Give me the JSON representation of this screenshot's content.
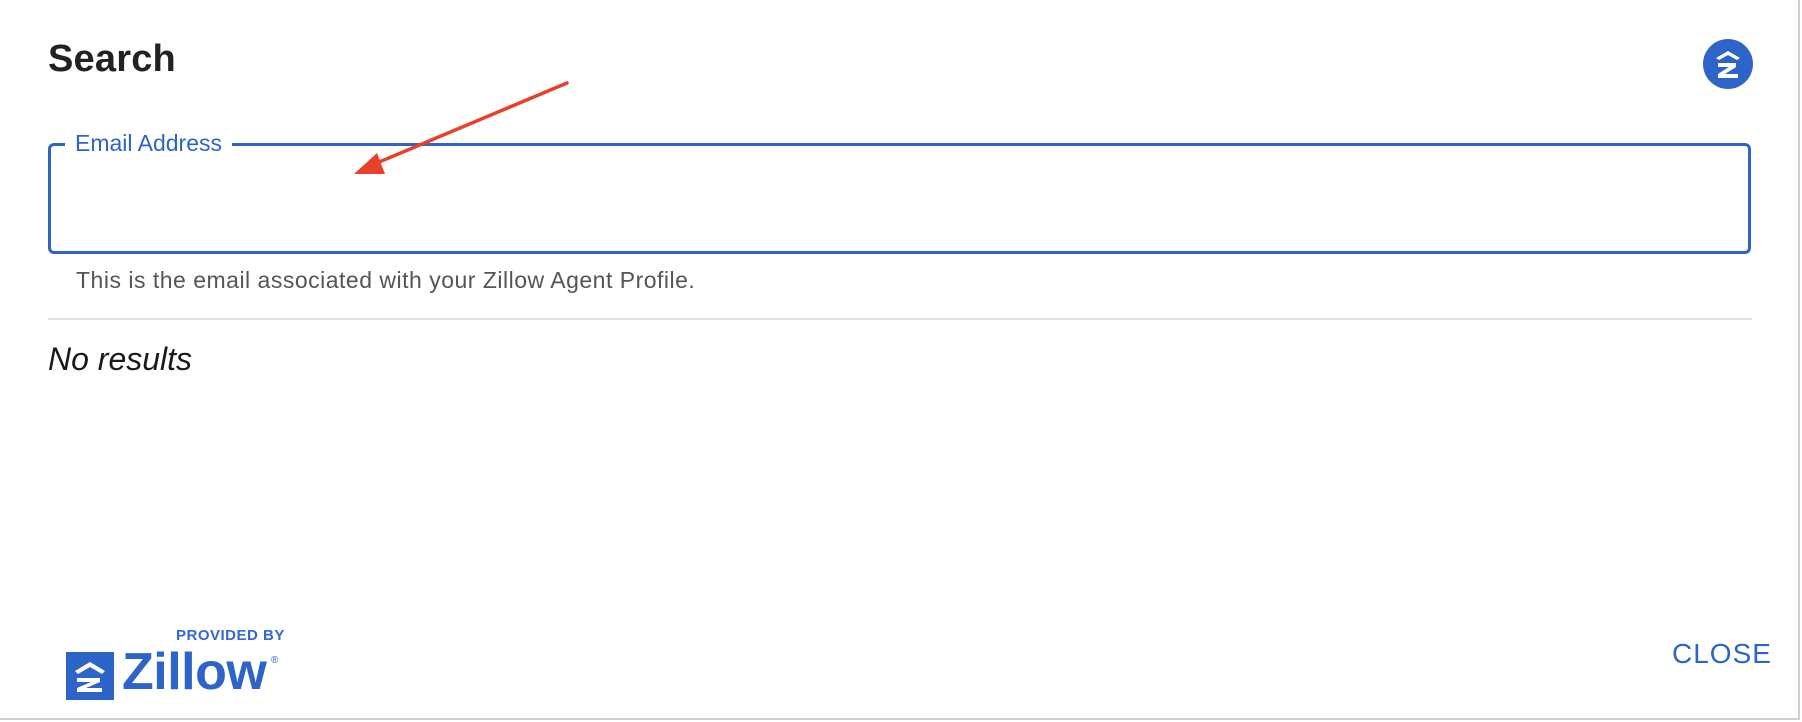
{
  "dialog": {
    "title": "Search",
    "close_label": "CLOSE"
  },
  "email_field": {
    "label": "Email Address",
    "value": "",
    "helper_text": "This is the email associated with your Zillow Agent Profile."
  },
  "results": {
    "empty_message": "No results"
  },
  "footer": {
    "provided_by": "PROVIDED BY",
    "brand": "Zillow",
    "registered_mark": "®"
  },
  "icons": {
    "header": "zillow-logo-icon",
    "annotation": "red-arrow-icon"
  },
  "colors": {
    "accent": "#2d64c8",
    "annotation": "#e8412a",
    "title": "#222222",
    "helper": "#555555"
  }
}
